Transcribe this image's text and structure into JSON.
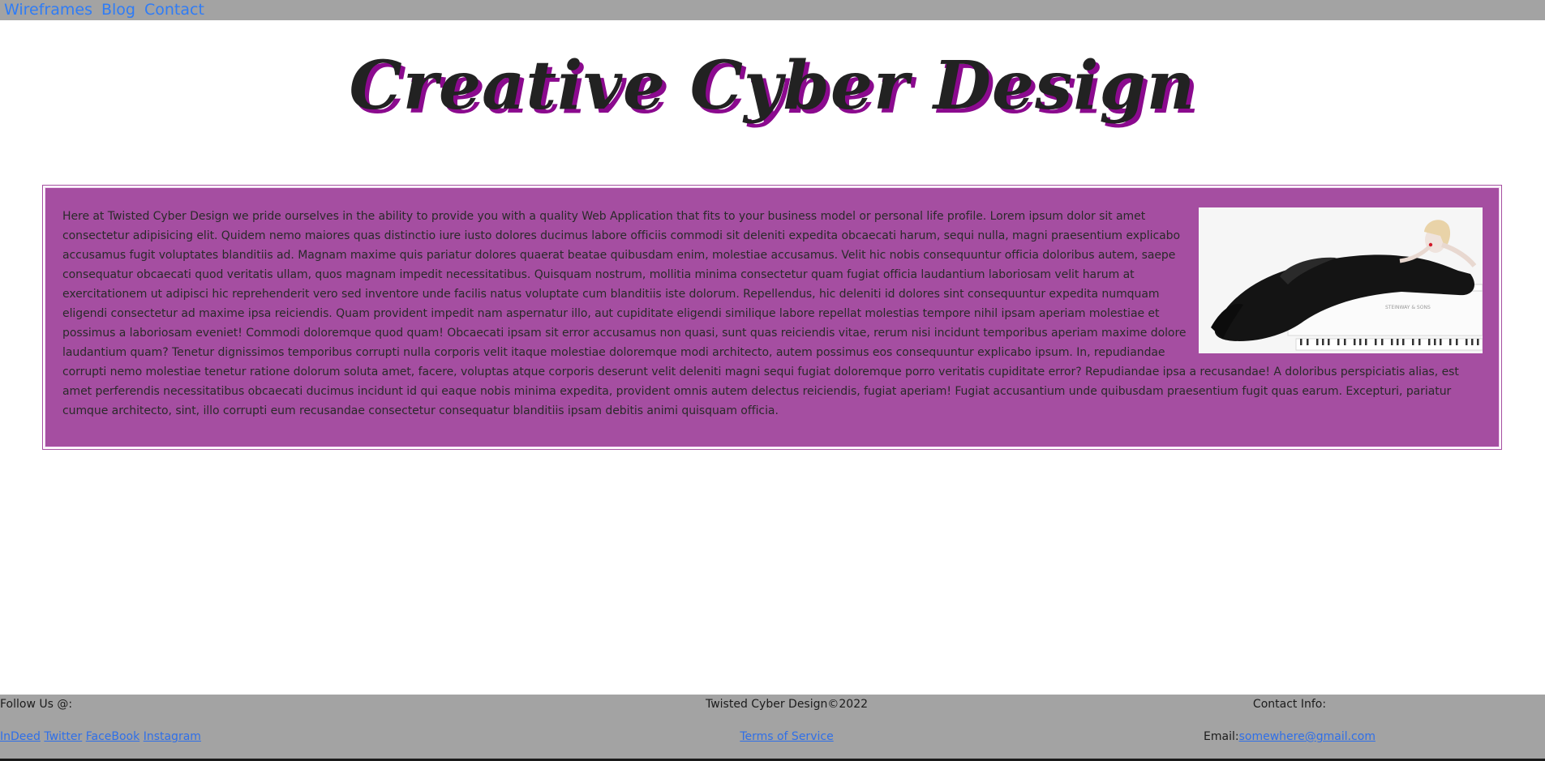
{
  "nav": {
    "items": [
      {
        "label": "Wireframes"
      },
      {
        "label": "Blog"
      },
      {
        "label": "Contact"
      }
    ]
  },
  "header": {
    "title": "Creative Cyber Design"
  },
  "main": {
    "paragraph": "Here at Twisted Cyber Design we pride ourselves in the ability to provide you with a quality Web Application that fits to your business model or personal life profile. Lorem ipsum dolor sit amet consectetur adipisicing elit. Quidem nemo maiores quas distinctio iure iusto dolores ducimus labore officiis commodi sit deleniti expedita obcaecati harum, sequi nulla, magni praesentium explicabo accusamus fugit voluptates blanditiis ad. Magnam maxime quis pariatur dolores quaerat beatae quibusdam enim, molestiae accusamus. Velit hic nobis consequuntur officia doloribus autem, saepe consequatur obcaecati quod veritatis ullam, quos magnam impedit necessitatibus. Quisquam nostrum, mollitia minima consectetur quam fugiat officia laudantium laboriosam velit harum at exercitationem ut adipisci hic reprehenderit vero sed inventore unde facilis natus voluptate cum blanditiis iste dolorum. Repellendus, hic deleniti id dolores sint consequuntur expedita numquam eligendi consectetur ad maxime ipsa reiciendis. Quam provident impedit nam aspernatur illo, aut cupiditate eligendi similique labore repellat molestias tempore nihil ipsam aperiam molestiae et possimus a laboriosam eveniet! Commodi doloremque quod quam! Obcaecati ipsam sit error accusamus non quasi, sunt quas reiciendis vitae, rerum nisi incidunt temporibus aperiam maxime dolore laudantium quam? Tenetur dignissimos temporibus corrupti nulla corporis velit itaque molestiae doloremque modi architecto, autem possimus eos consequuntur explicabo ipsum. In, repudiandae corrupti nemo molestiae tenetur ratione dolorum soluta amet, facere, voluptas atque corporis deserunt velit deleniti magni sequi fugiat doloremque porro veritatis cupiditate error? Repudiandae ipsa a recusandae! A doloribus perspiciatis alias, est amet perferendis necessitatibus obcaecati ducimus incidunt id qui eaque nobis minima expedita, provident omnis autem delectus reiciendis, fugiat aperiam! Fugiat accusantium unde quibusdam praesentium fugit quas earum. Excepturi, pariatur cumque architecto, sint, illo corrupti eum recusandae consectetur consequatur blanditiis ipsam debitis animi quisquam officia.",
    "image": {
      "icon": "woman-on-piano-photo"
    }
  },
  "footer": {
    "follow": {
      "heading": "Follow Us @:",
      "links": [
        {
          "label": "InDeed"
        },
        {
          "label": "Twitter"
        },
        {
          "label": "FaceBook"
        },
        {
          "label": "Instagram"
        }
      ]
    },
    "center": {
      "copyright": "Twisted Cyber Design©2022",
      "terms": "Terms of Service"
    },
    "contact": {
      "heading": "Contact Info:",
      "email_label": "Email:",
      "email": "somewhere@gmail.com"
    }
  },
  "colors": {
    "nav_bg": "#a3a3a3",
    "link": "#2f7cf6",
    "panel_bg": "#a54ea1",
    "title_shadow": "#8b0a8e"
  }
}
